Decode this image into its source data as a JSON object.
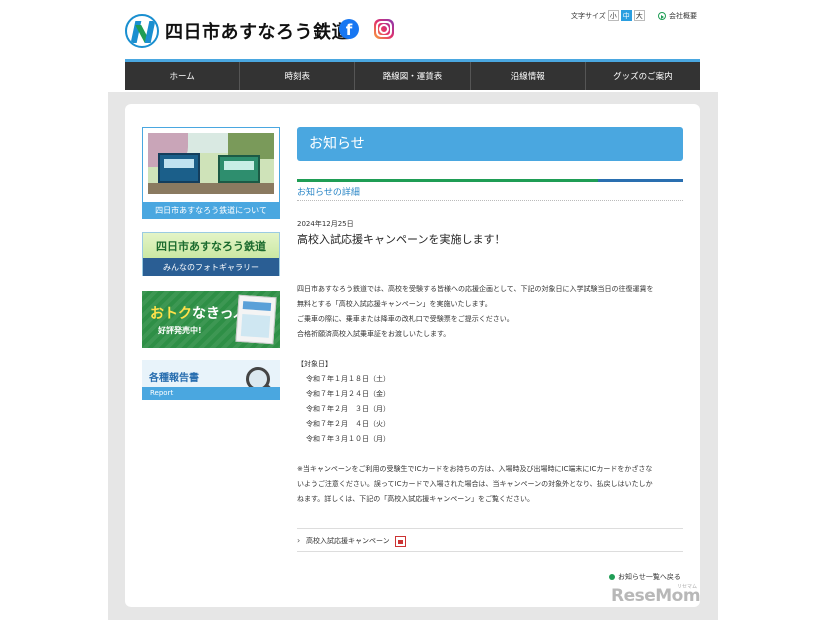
{
  "header": {
    "site_name": "四日市あすなろう鉄道",
    "fontsize_label": "文字サイズ",
    "fontsize_options": [
      "小",
      "中",
      "大"
    ],
    "fontsize_selected": "中",
    "company_link": "会社概要"
  },
  "nav": {
    "items": [
      "ホーム",
      "時刻表",
      "路線図・運賃表",
      "沿線情報",
      "グッズのご案内"
    ]
  },
  "sidebar": {
    "about_caption": "四日市あすなろう鉄道について",
    "gallery_title": "四日市あすなろう鉄道",
    "gallery_sub": "みんなのフォトギャラリー",
    "kippu_title_a": "おトク",
    "kippu_title_b": "なきっぷ",
    "kippu_sub": "好評発売中!",
    "report_title": "各種報告書",
    "report_sub": "Report"
  },
  "main": {
    "title": "お知らせ",
    "subhead": "お知らせの詳細",
    "date": "2024年12月25日",
    "news_title": "高校入試応援キャンペーンを実施します！",
    "paragraph1": [
      "四日市あすなろう鉄道では、高校を受験する皆様への応援企画として、下記の対象日に入学試験当日の往復運賃を",
      "無料とする「高校入試応援キャンペーン」を実施いたします。",
      "ご乗車の際に、乗車または降車の改札口で受験票をご提示ください。",
      "合格祈願済高校入試乗車証をお渡しいたします。"
    ],
    "target_label": "【対象日】",
    "target_dates": [
      "令和７年１月１８日（土）",
      "令和７年１月２４日（金）",
      "令和７年２月　３日（月）",
      "令和７年２月　４日（火）",
      "令和７年３月１０日（月）"
    ],
    "note": [
      "※当キャンペーンをご利用の受験生でICカードをお持ちの方は、入場時及び出場時にIC端末にICカードをかざさな",
      "いようご注意ください。誤ってICカードで入場された場合は、当キャンペーンの対象外となり、払戻しはいたしか",
      "ねます。詳しくは、下記の「高校入試応援キャンペーン」をご覧ください。"
    ],
    "link_label": "高校入試応援キャンペーン",
    "back_label": "お知らせ一覧へ戻る"
  },
  "watermark": "ReseMom",
  "watermark_small": "リセマム"
}
